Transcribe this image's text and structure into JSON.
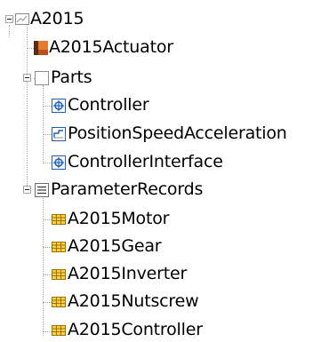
{
  "tree": {
    "root": {
      "label": "A2015",
      "icon": "model-icon",
      "expanded": true
    },
    "actuator": {
      "label": "A2015Actuator",
      "icon": "actuator-block-icon"
    },
    "parts": {
      "label": "Parts",
      "icon": "folder-icon",
      "expanded": true,
      "children": [
        {
          "label": "Controller",
          "icon": "component-icon"
        },
        {
          "label": "PositionSpeedAcceleration",
          "icon": "signal-icon"
        },
        {
          "label": "ControllerInterface",
          "icon": "component-icon"
        }
      ]
    },
    "parameter_records": {
      "label": "ParameterRecords",
      "icon": "list-icon",
      "expanded": true,
      "children": [
        {
          "label": "A2015Motor",
          "icon": "table-icon"
        },
        {
          "label": "A2015Gear",
          "icon": "table-icon"
        },
        {
          "label": "A2015Inverter",
          "icon": "table-icon"
        },
        {
          "label": "A2015Nutscrew",
          "icon": "table-icon"
        },
        {
          "label": "A2015Controller",
          "icon": "table-icon"
        }
      ]
    }
  },
  "colors": {
    "table_icon_fill": "#f5d24a",
    "table_icon_border": "#a66f00",
    "component_icon_blue": "#1d5fb9",
    "actuator_orange": "#e5792e",
    "actuator_dark": "#5a2b12",
    "tree_line": "#a8a8a8"
  }
}
